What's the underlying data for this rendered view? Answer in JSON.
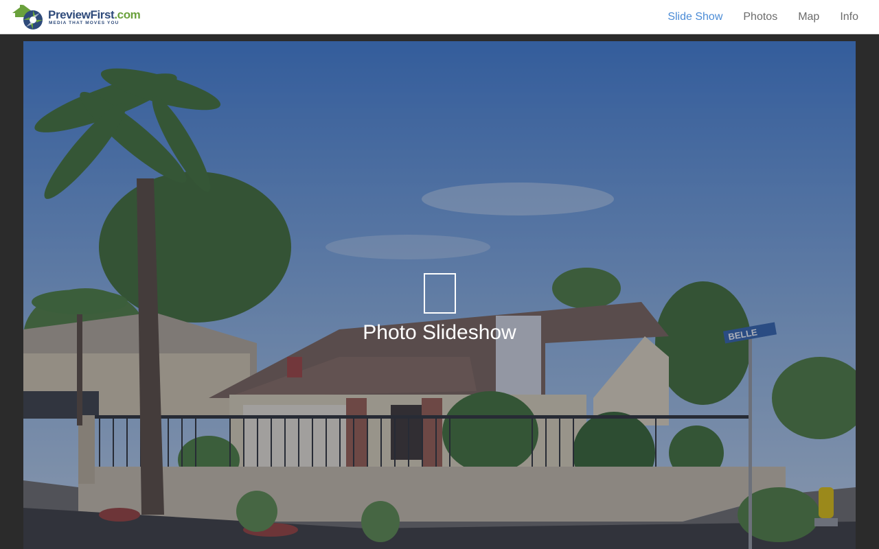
{
  "brand": {
    "name_part1": "Preview",
    "name_part2": "First",
    "name_part3": ".com",
    "tagline": "MEDIA THAT MOVES YOU",
    "colors": {
      "navy": "#2e4a7a",
      "green": "#6aa13c"
    }
  },
  "nav": {
    "items": [
      {
        "label": "Slide Show",
        "active": true
      },
      {
        "label": "Photos",
        "active": false
      },
      {
        "label": "Map",
        "active": false
      },
      {
        "label": "Info",
        "active": false
      }
    ],
    "active_color": "#4a8bd6",
    "color": "#6b6b6b"
  },
  "hero": {
    "street_sign": "BELLE",
    "play_label": "Photo Slideshow",
    "play_icon": "play-icon"
  }
}
